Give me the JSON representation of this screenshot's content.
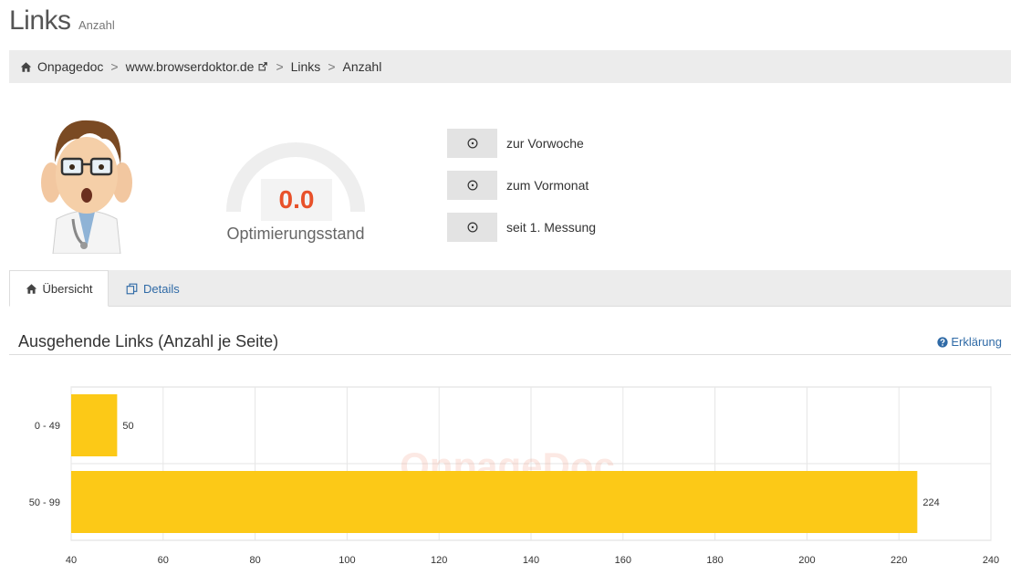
{
  "header": {
    "title": "Links",
    "subtitle": "Anzahl"
  },
  "breadcrumb": {
    "items": [
      "Onpagedoc",
      "www.browserdoktor.de",
      "Links",
      "Anzahl"
    ],
    "separator": ">"
  },
  "score": {
    "value": "0.0",
    "label": "Optimierungsstand",
    "value_color": "#e8512a"
  },
  "comparisons": [
    {
      "label": "zur Vorwoche",
      "icon": "clock-icon"
    },
    {
      "label": "zum Vormonat",
      "icon": "clock-icon"
    },
    {
      "label": "seit 1. Messung",
      "icon": "clock-icon"
    }
  ],
  "tabs": [
    {
      "label": "Übersicht",
      "icon": "home-icon",
      "active": true
    },
    {
      "label": "Details",
      "icon": "copy-icon",
      "active": false
    }
  ],
  "section": {
    "title": "Ausgehende Links (Anzahl je Seite)",
    "help_label": "Erklärung"
  },
  "colors": {
    "bar": "#fcc917",
    "link": "#2f6aa6",
    "accent": "#e8512a"
  },
  "chart_data": {
    "type": "bar",
    "orientation": "horizontal",
    "categories": [
      "0 - 49",
      "50 - 99"
    ],
    "values": [
      50,
      224
    ],
    "data_labels": [
      "50",
      "224"
    ],
    "xlim": [
      40,
      240
    ],
    "xticks": [
      "40",
      "60",
      "80",
      "100",
      "120",
      "140",
      "160",
      "180",
      "200",
      "220",
      "240"
    ],
    "grid": true,
    "watermark": "OnpageDoc"
  }
}
